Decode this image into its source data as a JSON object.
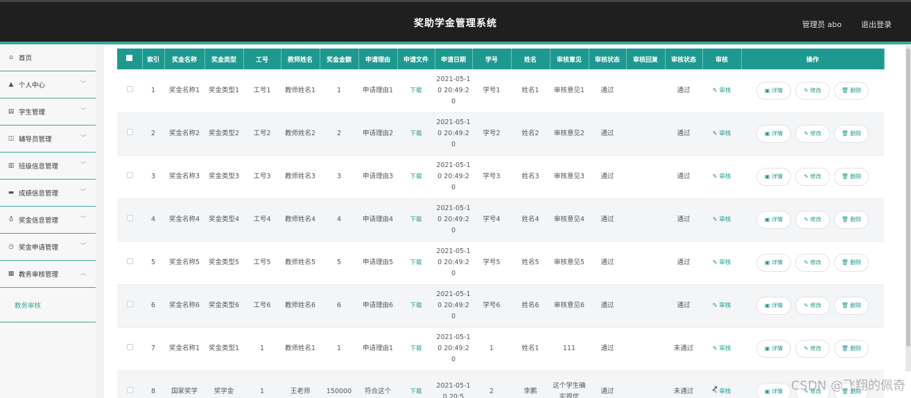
{
  "header": {
    "title": "奖助学金管理系统",
    "user": "管理员 abo",
    "logout": "退出登录"
  },
  "sidebar": {
    "items": [
      {
        "icon": "⌂",
        "label": "首页",
        "chevron": ""
      },
      {
        "icon": "▲",
        "label": "个人中心",
        "chevron": "﹀"
      },
      {
        "icon": "▤",
        "label": "学生管理",
        "chevron": "﹀"
      },
      {
        "icon": "◫",
        "label": "辅导员管理",
        "chevron": "﹀"
      },
      {
        "icon": "▥",
        "label": "班级信息管理",
        "chevron": "﹀"
      },
      {
        "icon": "▬",
        "label": "成绩信息管理",
        "chevron": "﹀"
      },
      {
        "icon": "♁",
        "label": "奖金信息管理",
        "chevron": "﹀"
      },
      {
        "icon": "◷",
        "label": "奖金申请管理",
        "chevron": "﹀"
      },
      {
        "icon": "▩",
        "label": "教务审核管理",
        "chevron": "︿"
      }
    ],
    "sub": "教务审核"
  },
  "table": {
    "columns": [
      "",
      "索引",
      "奖金名称",
      "奖金类型",
      "工号",
      "教师姓名",
      "奖金金额",
      "申请理由",
      "申请文件",
      "申请日期",
      "学号",
      "姓名",
      "审核意见",
      "审核状态",
      "审核回复",
      "审核状态",
      "审核",
      "操作"
    ],
    "download_label": "下载",
    "audit_label": "✎ 审核",
    "buttons": {
      "detail": "▣ 详情",
      "edit": "✎ 修改",
      "delete": "🗑 删除"
    },
    "rows": [
      {
        "idx": "1",
        "name": "奖金名称1",
        "type": "奖金类型1",
        "staff": "工号1",
        "teacher": "教师姓名1",
        "amount": "1",
        "reason": "申请理由1",
        "date": "2021-05-10 20:49:20",
        "stuno": "学号1",
        "stuname": "姓名1",
        "opinion": "审核意见1",
        "status": "通过",
        "reply": "",
        "status2": "通过"
      },
      {
        "idx": "2",
        "name": "奖金名称2",
        "type": "奖金类型2",
        "staff": "工号2",
        "teacher": "教师姓名2",
        "amount": "2",
        "reason": "申请理由2",
        "date": "2021-05-10 20:49:20",
        "stuno": "学号2",
        "stuname": "姓名2",
        "opinion": "审核意见2",
        "status": "通过",
        "reply": "",
        "status2": "通过"
      },
      {
        "idx": "3",
        "name": "奖金名称3",
        "type": "奖金类型3",
        "staff": "工号3",
        "teacher": "教师姓名3",
        "amount": "3",
        "reason": "申请理由3",
        "date": "2021-05-10 20:49:20",
        "stuno": "学号3",
        "stuname": "姓名3",
        "opinion": "审核意见3",
        "status": "通过",
        "reply": "",
        "status2": "通过"
      },
      {
        "idx": "4",
        "name": "奖金名称4",
        "type": "奖金类型4",
        "staff": "工号4",
        "teacher": "教师姓名4",
        "amount": "4",
        "reason": "申请理由4",
        "date": "2021-05-10 20:49:20",
        "stuno": "学号4",
        "stuname": "姓名4",
        "opinion": "审核意见4",
        "status": "通过",
        "reply": "",
        "status2": "通过"
      },
      {
        "idx": "5",
        "name": "奖金名称5",
        "type": "奖金类型5",
        "staff": "工号5",
        "teacher": "教师姓名5",
        "amount": "5",
        "reason": "申请理由5",
        "date": "2021-05-10 20:49:20",
        "stuno": "学号5",
        "stuname": "姓名5",
        "opinion": "审核意见5",
        "status": "通过",
        "reply": "",
        "status2": "通过"
      },
      {
        "idx": "6",
        "name": "奖金名称6",
        "type": "奖金类型6",
        "staff": "工号6",
        "teacher": "教师姓名6",
        "amount": "6",
        "reason": "申请理由6",
        "date": "2021-05-10 20:49:20",
        "stuno": "学号6",
        "stuname": "姓名6",
        "opinion": "审核意见6",
        "status": "通过",
        "reply": "",
        "status2": "通过"
      },
      {
        "idx": "7",
        "name": "奖金名称1",
        "type": "奖金类型1",
        "staff": "1",
        "teacher": "教师姓名1",
        "amount": "1",
        "reason": "申请理由1",
        "date": "2021-05-10 20:49:20",
        "stuno": "1",
        "stuname": "姓名1",
        "opinion": "111",
        "status": "通过",
        "reply": "",
        "status2": "未通过"
      },
      {
        "idx": "8",
        "name": "国家奖学",
        "type": "奖学金",
        "staff": "1",
        "teacher": "王老师",
        "amount": "150000",
        "reason": "符合这个",
        "date": "2021-05-10 20:5",
        "stuno": "2",
        "stuname": "李鹏",
        "opinion": "这个学生确实很优",
        "status": "通过",
        "reply": "",
        "status2": "未通过"
      }
    ]
  },
  "watermark": "CSDN @飞翔的佩奇",
  "colors": {
    "accent": "#1e9990",
    "topbar": "#1f1f1f",
    "teal_line": "#3aa89b"
  }
}
